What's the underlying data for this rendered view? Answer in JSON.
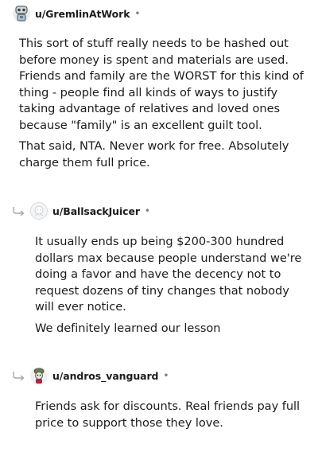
{
  "comments": [
    {
      "username": "u/GremlinAtWork",
      "separator": "•",
      "avatar_icon": "robot-avatar-icon",
      "paragraphs": [
        "This sort of stuff really needs to be hashed out before money is spent and materials are used. Friends and family are the WORST for this kind of thing - people find all kinds of ways to justify taking advantage of relatives and loved ones because \"family\" is an excellent guilt tool.",
        "That said, NTA. Never work for free. Absolutely charge them full price."
      ]
    },
    {
      "username": "u/BallsackJuicer",
      "separator": "•",
      "avatar_icon": "default-avatar-icon",
      "paragraphs": [
        "It usually ends up being $200-300 hundred dollars max because people understand we're doing a favor and have the decency not to request dozens of tiny changes that nobody will ever notice.",
        "We definitely learned our lesson"
      ]
    },
    {
      "username": "u/andros_vanguard",
      "separator": "•",
      "avatar_icon": "robot-avatar-icon",
      "paragraphs": [
        "Friends ask for discounts. Real friends pay full price to support those they love."
      ]
    }
  ],
  "colors": {
    "text": "#1c1c1c",
    "meta": "#7c7c7c",
    "reply_arrow": "#a5a8ab"
  }
}
